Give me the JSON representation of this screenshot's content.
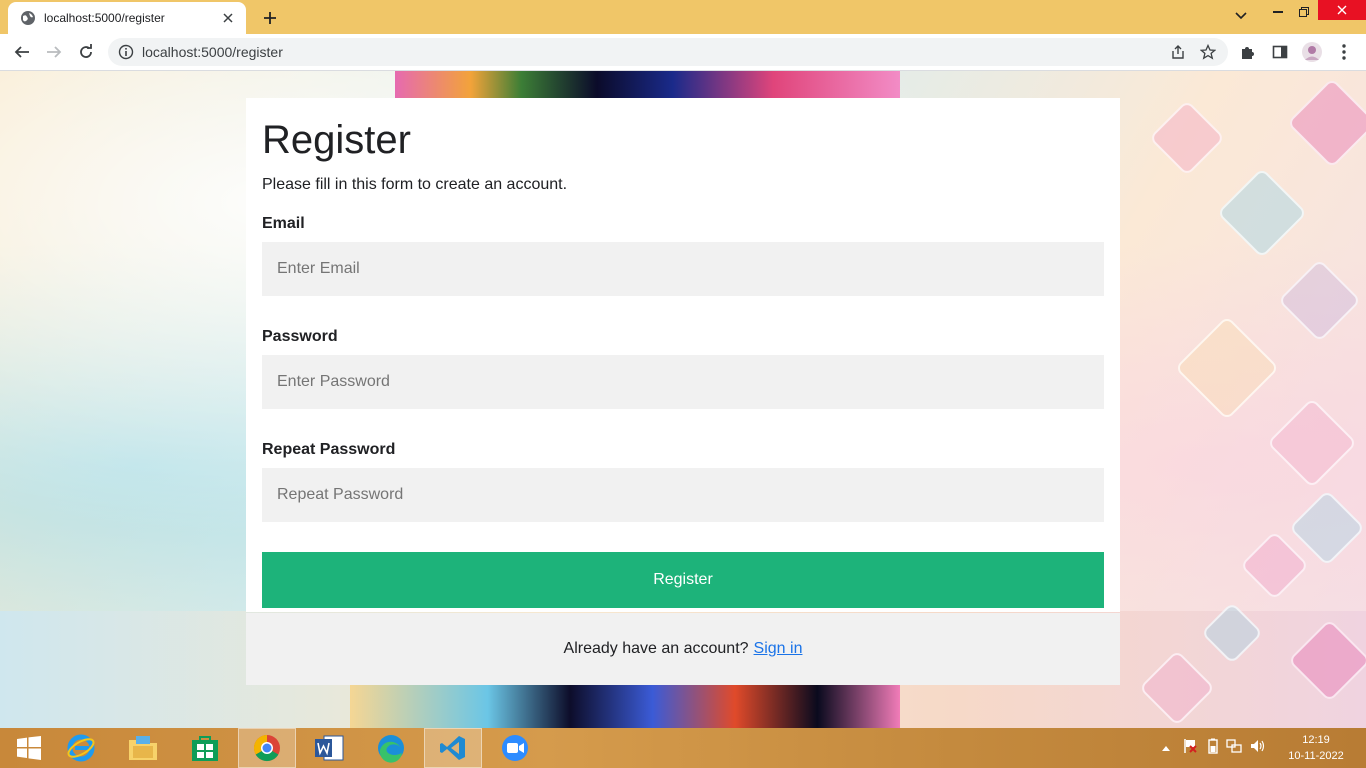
{
  "browser": {
    "tab_title": "localhost:5000/register",
    "url": "localhost:5000/register"
  },
  "form": {
    "title": "Register",
    "subtitle": "Please fill in this form to create an account.",
    "email_label": "Email",
    "email_placeholder": "Enter Email",
    "password_label": "Password",
    "password_placeholder": "Enter Password",
    "repeat_label": "Repeat Password",
    "repeat_placeholder": "Repeat Password",
    "submit_label": "Register"
  },
  "signin": {
    "prompt": "Already have an account?",
    "link_label": "Sign in"
  },
  "taskbar": {
    "apps": [
      "start",
      "internet-explorer",
      "file-explorer",
      "store",
      "chrome",
      "word",
      "edge",
      "vscode",
      "zoom"
    ],
    "time": "12:19",
    "date": "10-11-2022"
  },
  "colors": {
    "register_button": "#1db37a",
    "tabstrip": "#f0c668",
    "link": "#1a73e8"
  }
}
